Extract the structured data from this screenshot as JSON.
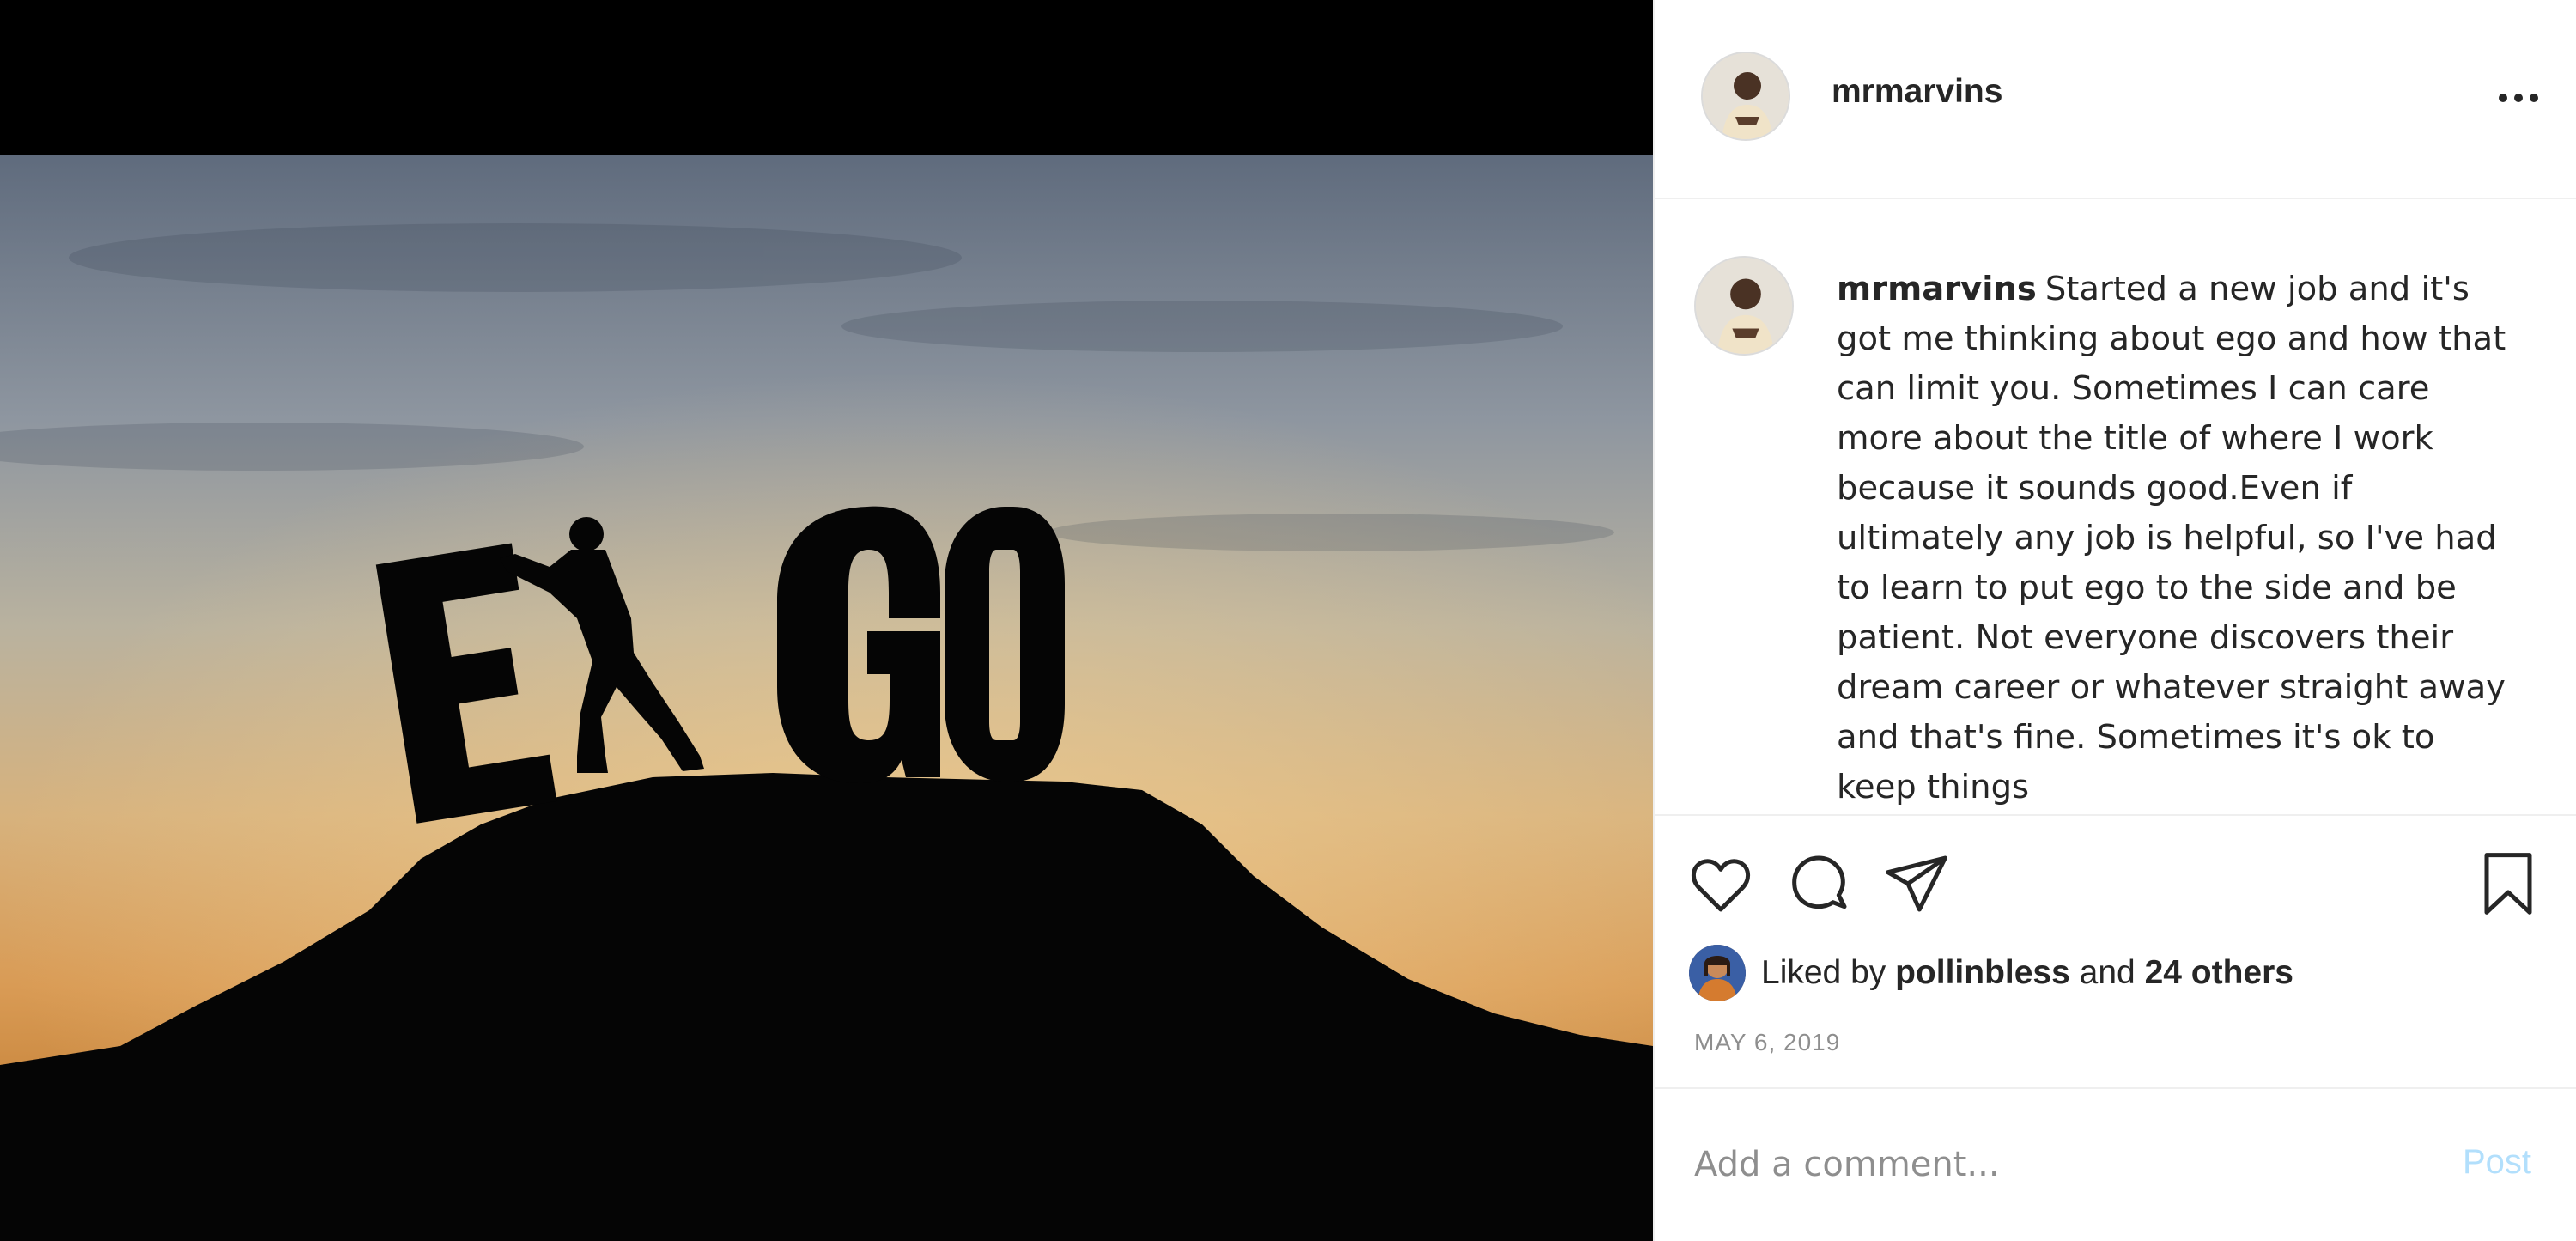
{
  "post": {
    "image_alt": "EGO letters silhouette at sunset",
    "author": {
      "username": "mrmarvins"
    },
    "caption": {
      "username": "mrmarvins",
      "text": "Started a new job and it's got me thinking about ego and how that can limit you. Sometimes I can care more about the title of where I work because it sounds good.Even if ultimately any job is helpful, so I've had to learn to put ego to the side and be patient. Not everyone discovers their dream career or whatever straight away and that's fine. Sometimes it's ok to keep things"
    },
    "likes": {
      "prefix": "Liked by",
      "first_liker": "pollinbless",
      "connector": "and",
      "others": "24 others"
    },
    "date": "MAY 6, 2019"
  },
  "comment_box": {
    "placeholder": "Add a comment...",
    "post_label": "Post"
  },
  "colors": {
    "text": "#262626",
    "muted": "#8e8e8e",
    "post_disabled": "#b2dffc",
    "border": "#efefef"
  },
  "icons": [
    "more-icon",
    "heart-icon",
    "comment-icon",
    "share-icon",
    "bookmark-icon"
  ]
}
